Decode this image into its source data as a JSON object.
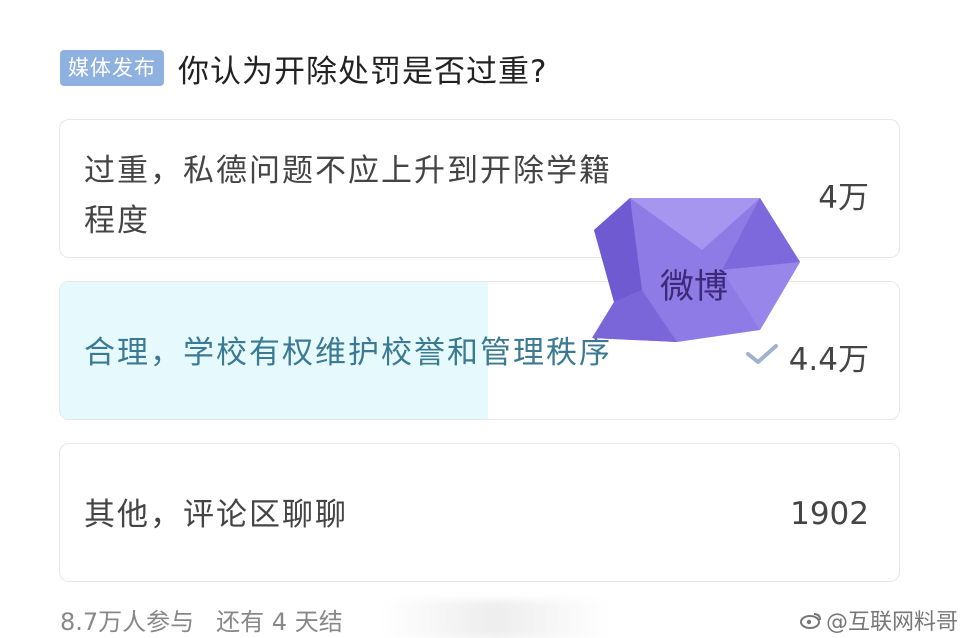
{
  "header": {
    "badge": "媒体发布",
    "question": "你认为开除处罚是否过重?"
  },
  "options": [
    {
      "line1": "过重，私德问题不应上升到开除学籍",
      "line2": "程度",
      "count": "4万",
      "fill_percent": 0
    },
    {
      "line1": "合理，学校有权维护校誉和管理秩序",
      "count": "4.4万",
      "fill_percent": 51,
      "selected": true
    },
    {
      "line1": "其他，评论区聊聊",
      "count": "1902",
      "fill_percent": 0
    }
  ],
  "footer": {
    "participants": "8.7万人参与",
    "remaining": "还有 4 天结"
  },
  "overlay": {
    "weibo_text": "微博",
    "watermark": "@互联网料哥"
  },
  "colors": {
    "badge_bg": "#8fb1e0",
    "selected_fill": "#e6fafd",
    "selected_text": "#3a7a92",
    "weibo_purple": "#8f7be6"
  }
}
